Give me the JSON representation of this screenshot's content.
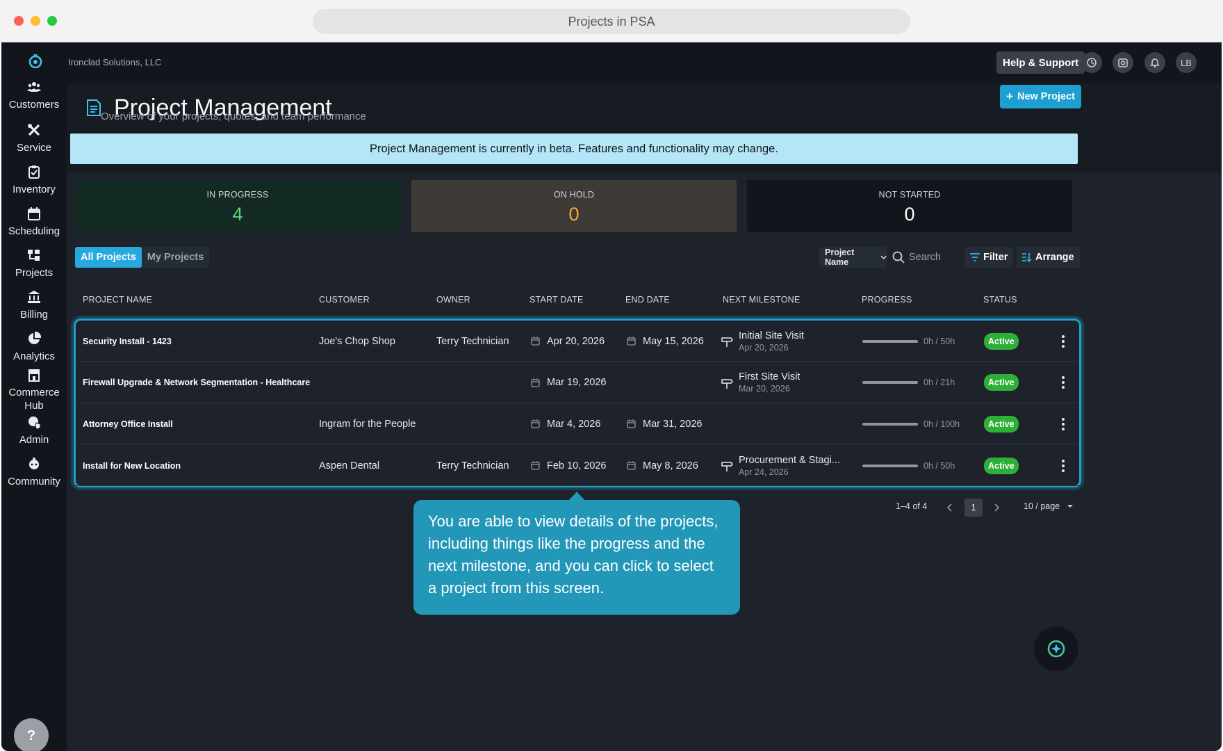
{
  "browser": {
    "title": "Projects in PSA"
  },
  "sidebar": {
    "items": [
      {
        "label": "Customers",
        "icon": "customers-icon"
      },
      {
        "label": "Service",
        "icon": "tools-icon"
      },
      {
        "label": "Inventory",
        "icon": "clipboard-icon"
      },
      {
        "label": "Scheduling",
        "icon": "calendar-icon"
      },
      {
        "label": "Projects",
        "icon": "projects-icon"
      },
      {
        "label": "Billing",
        "icon": "bank-icon"
      },
      {
        "label": "Analytics",
        "icon": "pie-chart-icon"
      },
      {
        "label": "Commerce Hub",
        "icon": "store-icon"
      },
      {
        "label": "Admin",
        "icon": "admin-shield-icon"
      },
      {
        "label": "Community",
        "icon": "community-icon"
      }
    ],
    "help_label": "?"
  },
  "topbar": {
    "org_name": "Ironclad Solutions, LLC",
    "help_support": "Help & Support",
    "avatar_initials": "LB"
  },
  "header": {
    "title": "Project Management",
    "subtitle": "Overview of your projects, quotes, and team performance",
    "new_project": "New Project"
  },
  "beta_banner": "Project Management is currently in beta. Features and functionality may change.",
  "stats": [
    {
      "label": "IN PROGRESS",
      "value": "4"
    },
    {
      "label": "ON HOLD",
      "value": "0"
    },
    {
      "label": "NOT STARTED",
      "value": "0"
    }
  ],
  "toolbar": {
    "tabs": [
      "All Projects",
      "My Projects"
    ],
    "search_field": "Project Name",
    "search_placeholder": "Search",
    "filter": "Filter",
    "arrange": "Arrange"
  },
  "table": {
    "columns": [
      "PROJECT NAME",
      "CUSTOMER",
      "OWNER",
      "START DATE",
      "END DATE",
      "NEXT MILESTONE",
      "PROGRESS",
      "STATUS"
    ],
    "rows": [
      {
        "name": "Security Install - 1423",
        "customer": "Joe's Chop Shop",
        "owner": "Terry Technician",
        "start": "Apr 20, 2026",
        "end": "May 15, 2026",
        "milestone": "Initial Site Visit",
        "milestone_date": "Apr 20, 2026",
        "progress_text": "0h / 50h",
        "progress": 0,
        "status": "Active"
      },
      {
        "name": "Firewall Upgrade & Network Segmentation - Healthcare",
        "customer": "",
        "owner": "",
        "start": "Mar 19, 2026",
        "end": "",
        "milestone": "First Site Visit",
        "milestone_date": "Mar 20, 2026",
        "progress_text": "0h / 21h",
        "progress": 0,
        "status": "Active"
      },
      {
        "name": "Attorney Office Install",
        "customer": "Ingram for the People",
        "owner": "",
        "start": "Mar 4, 2026",
        "end": "Mar 31, 2026",
        "milestone": "",
        "milestone_date": "",
        "progress_text": "0h / 100h",
        "progress": 0,
        "status": "Active"
      },
      {
        "name": "Install for New Location",
        "customer": "Aspen Dental",
        "owner": "Terry Technician",
        "start": "Feb 10, 2026",
        "end": "May 8, 2026",
        "milestone": "Procurement & Stagi...",
        "milestone_date": "Apr 24, 2026",
        "progress_text": "0h / 50h",
        "progress": 0,
        "status": "Active"
      }
    ]
  },
  "pagination": {
    "range": "1–4 of 4",
    "page": "1",
    "page_size": "10 / page"
  },
  "tooltip": "You are able to view details of the projects, including things like the progress and the next milestone, and you can click to select a project from this screen.",
  "colors": {
    "accent": "#27a8df",
    "active": "#2eaf38",
    "in_progress": "#5fd37a",
    "on_hold": "#f3a83b",
    "tooltip": "#2297b8"
  }
}
